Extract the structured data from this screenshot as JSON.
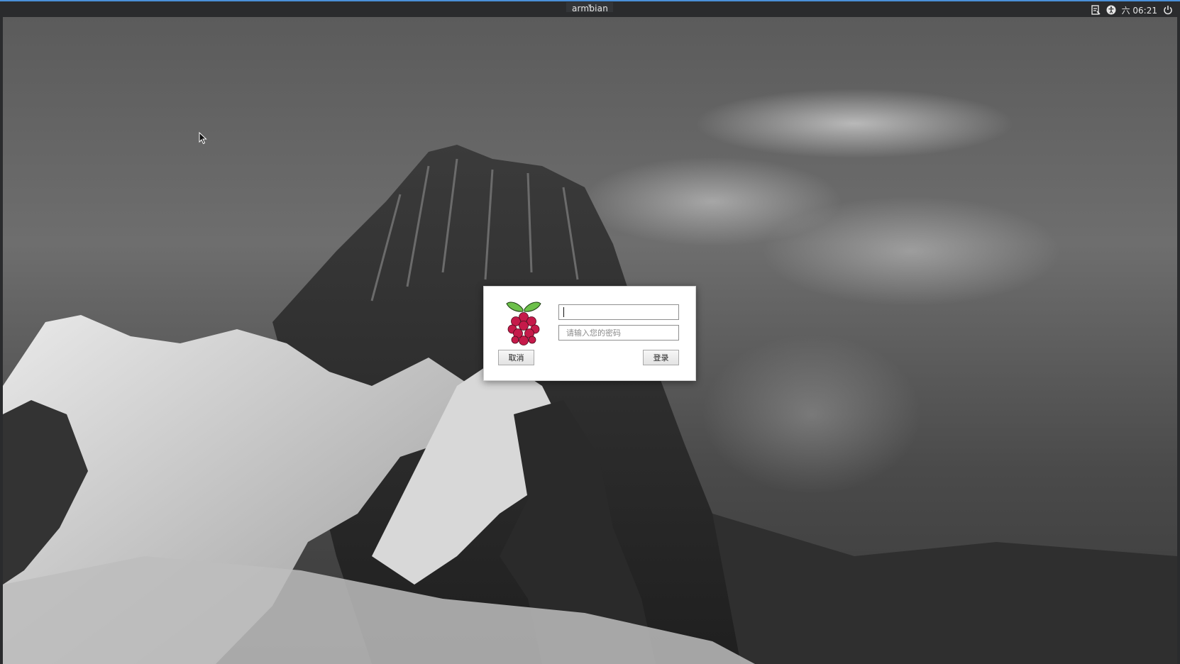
{
  "topbar": {
    "handle_glyph": "▾",
    "title": "armbian",
    "clock": "六 06:21",
    "icons": [
      "keyboard-layout-icon",
      "accessibility-icon",
      "power-icon"
    ]
  },
  "desktop": {
    "wallpaper": "snowy-mountain-with-clouds-grayscale"
  },
  "login_dialog": {
    "logo": "raspberry-pi-logo",
    "username": {
      "value": "",
      "placeholder": ""
    },
    "password": {
      "value": "",
      "placeholder": "请输入您的密码"
    },
    "cancel_label": "取消",
    "login_label": "登录"
  },
  "colors": {
    "topbar_bg": "#2a2b2d",
    "topbar_accent": "#4a90d9",
    "dialog_bg": "#ffffff",
    "logo_berry": "#c51a4a",
    "logo_leaf": "#6cc04a"
  }
}
